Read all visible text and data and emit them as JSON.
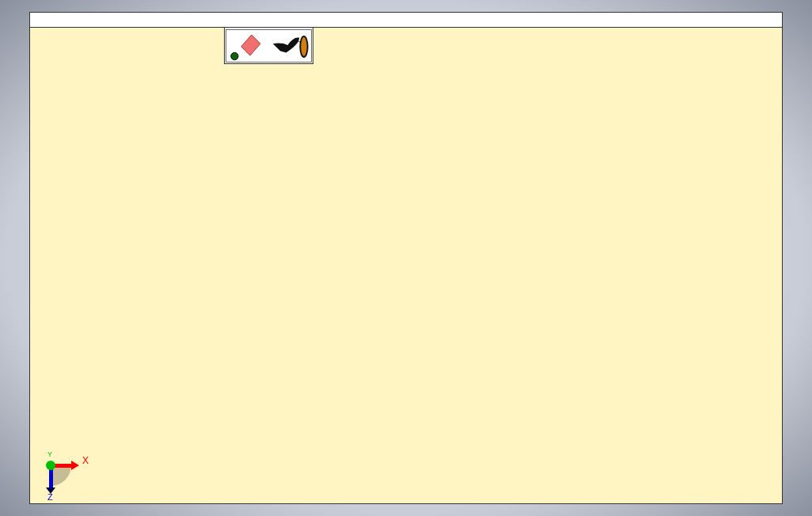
{
  "triad": {
    "axes": [
      {
        "label": "X",
        "color": "#ff0000"
      },
      {
        "label": "Y",
        "color": "#00c000"
      },
      {
        "label": "Z",
        "color": "#0000cc"
      }
    ]
  }
}
